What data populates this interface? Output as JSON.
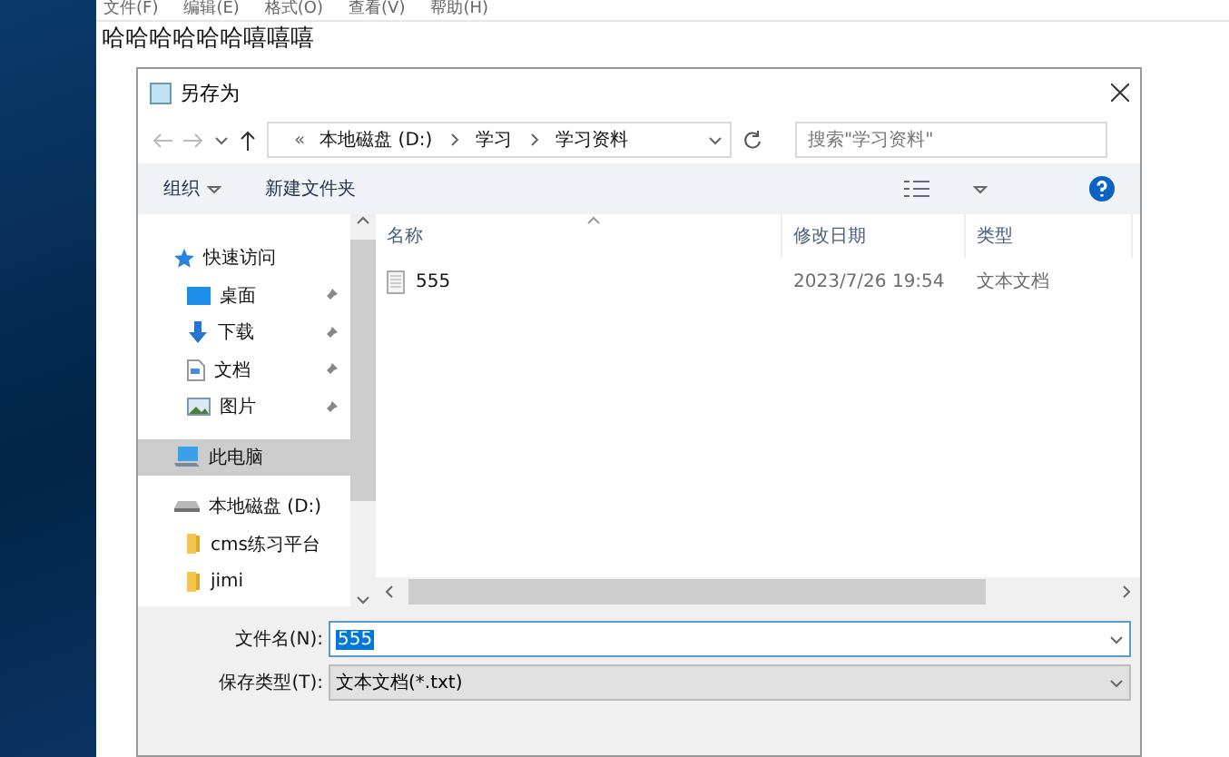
{
  "notepad": {
    "menu": [
      "文件(F)",
      "编辑(E)",
      "格式(O)",
      "查看(V)",
      "帮助(H)"
    ],
    "text": "哈哈哈哈哈哈嘻嘻嘻"
  },
  "dialog": {
    "title": "另存为",
    "address": {
      "overflow": "«",
      "segments": [
        "本地磁盘 (D:)",
        "学习",
        "学习资料"
      ]
    },
    "search": {
      "placeholder": "搜索\"学习资料\""
    },
    "toolbar": {
      "organize": "组织",
      "new_folder": "新建文件夹"
    },
    "nav": [
      {
        "label": "快速访问",
        "kind": "star",
        "selected": false,
        "children": [
          {
            "label": "桌面",
            "kind": "desktop",
            "pinned": true,
            "selected": false
          },
          {
            "label": "下载",
            "kind": "download",
            "pinned": true,
            "selected": false
          },
          {
            "label": "文档",
            "kind": "document",
            "pinned": true,
            "selected": false
          },
          {
            "label": "图片",
            "kind": "picture",
            "pinned": true,
            "selected": false
          }
        ]
      },
      {
        "label": "此电脑",
        "kind": "pc",
        "selected": true
      },
      {
        "label": "本地磁盘 (D:)",
        "kind": "drive",
        "selected": false,
        "children": [
          {
            "label": "cms练习平台",
            "kind": "folder",
            "pinned": false,
            "selected": false
          },
          {
            "label": "jimi",
            "kind": "folder",
            "pinned": false,
            "selected": false
          }
        ]
      }
    ],
    "columns": [
      {
        "label": "名称",
        "sorted": true
      },
      {
        "label": "修改日期",
        "sorted": false
      },
      {
        "label": "类型",
        "sorted": false
      }
    ],
    "files": [
      {
        "name": "555",
        "modified": "2023/7/26 19:54",
        "type": "文本文档",
        "selected": false
      }
    ],
    "form": {
      "filename_label": "文件名(N):",
      "filename": "555",
      "filetype_label": "保存类型(T):",
      "filetype": "文本文档(*.txt)"
    }
  }
}
